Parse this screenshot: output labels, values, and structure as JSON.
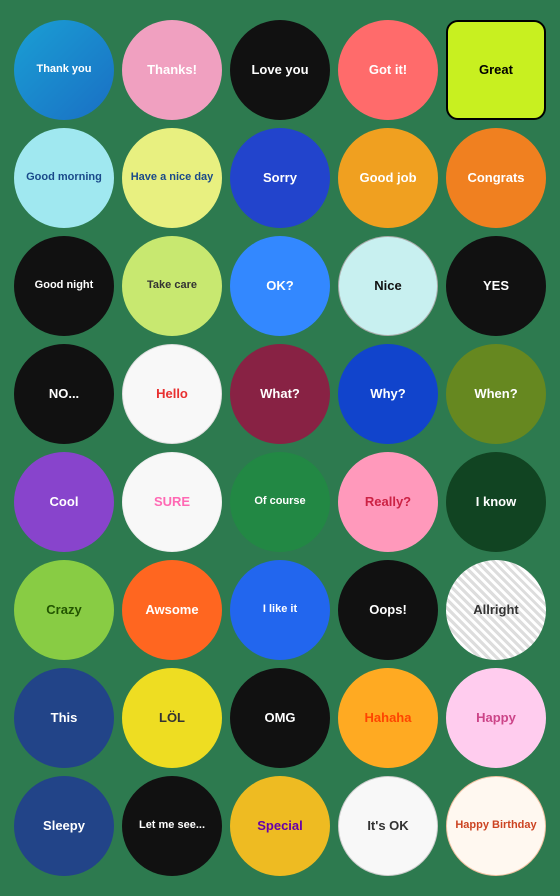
{
  "stickers": [
    {
      "id": "thank-you",
      "label": "Thank you",
      "class": "s-thank-you"
    },
    {
      "id": "thanks",
      "label": "Thanks!",
      "class": "s-thanks"
    },
    {
      "id": "love-you",
      "label": "Love you",
      "class": "s-love-you"
    },
    {
      "id": "got-it",
      "label": "Got it!",
      "class": "s-got-it"
    },
    {
      "id": "great",
      "label": "Great",
      "class": "s-great"
    },
    {
      "id": "good-morning",
      "label": "Good morning",
      "class": "s-good-morning"
    },
    {
      "id": "have-a-nice-day",
      "label": "Have a nice day",
      "class": "s-have-a-nice-day"
    },
    {
      "id": "sorry",
      "label": "Sorry",
      "class": "s-sorry"
    },
    {
      "id": "good-job",
      "label": "Good job",
      "class": "s-good-job"
    },
    {
      "id": "congrats",
      "label": "Congrats",
      "class": "s-congrats"
    },
    {
      "id": "good-night",
      "label": "Good night",
      "class": "s-good-night"
    },
    {
      "id": "take-care",
      "label": "Take care",
      "class": "s-take-care"
    },
    {
      "id": "ok",
      "label": "OK?",
      "class": "s-ok"
    },
    {
      "id": "nice",
      "label": "Nice",
      "class": "s-nice"
    },
    {
      "id": "yes",
      "label": "YES",
      "class": "s-yes"
    },
    {
      "id": "no",
      "label": "NO...",
      "class": "s-no"
    },
    {
      "id": "hello",
      "label": "Hello",
      "class": "s-hello"
    },
    {
      "id": "what",
      "label": "What?",
      "class": "s-what"
    },
    {
      "id": "why",
      "label": "Why?",
      "class": "s-why"
    },
    {
      "id": "when",
      "label": "When?",
      "class": "s-when"
    },
    {
      "id": "cool",
      "label": "Cool",
      "class": "s-cool"
    },
    {
      "id": "sure",
      "label": "SURE",
      "class": "s-sure"
    },
    {
      "id": "of-course",
      "label": "Of course",
      "class": "s-of-course"
    },
    {
      "id": "really",
      "label": "Really?",
      "class": "s-really"
    },
    {
      "id": "i-know",
      "label": "I know",
      "class": "s-i-know"
    },
    {
      "id": "crazy",
      "label": "Crazy",
      "class": "s-crazy"
    },
    {
      "id": "awsome",
      "label": "Awsome",
      "class": "s-awsome"
    },
    {
      "id": "i-like-it",
      "label": "I like it",
      "class": "s-i-like-it"
    },
    {
      "id": "oops",
      "label": "Oops!",
      "class": "s-oops"
    },
    {
      "id": "allright",
      "label": "Allright",
      "class": "s-allright"
    },
    {
      "id": "this",
      "label": "This",
      "class": "s-this"
    },
    {
      "id": "lol",
      "label": "LÖL",
      "class": "s-lol"
    },
    {
      "id": "omg",
      "label": "OMG",
      "class": "s-omg"
    },
    {
      "id": "hahaha",
      "label": "Hahaha",
      "class": "s-hahaha"
    },
    {
      "id": "happy",
      "label": "Happy",
      "class": "s-happy"
    },
    {
      "id": "sleepy",
      "label": "Sleepy",
      "class": "s-sleepy"
    },
    {
      "id": "let-me-see",
      "label": "Let me see...",
      "class": "s-let-me-see"
    },
    {
      "id": "special",
      "label": "Special",
      "class": "s-special"
    },
    {
      "id": "its-ok",
      "label": "It's OK",
      "class": "s-its-ok"
    },
    {
      "id": "happy-birthday",
      "label": "Happy Birthday",
      "class": "s-happy-birthday"
    }
  ]
}
